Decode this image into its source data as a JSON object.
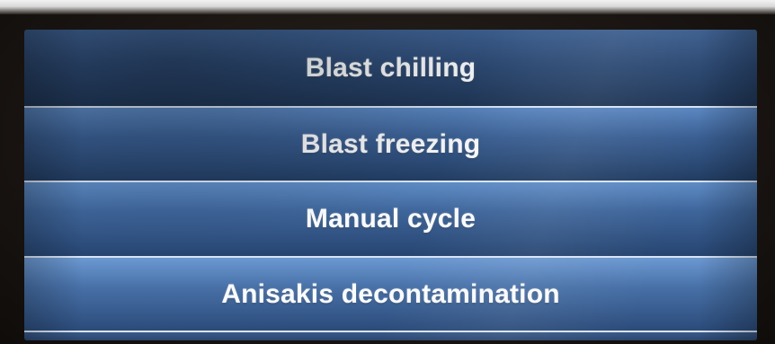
{
  "menu": {
    "items": [
      {
        "label": "Blast chilling"
      },
      {
        "label": "Blast freezing"
      },
      {
        "label": "Manual cycle"
      },
      {
        "label": "Anisakis decontamination"
      }
    ]
  },
  "colors": {
    "screen_background": "#1b2a40",
    "button_top": "#5a86c0",
    "button_bottom": "#223d63",
    "divider": "#d8e4f4",
    "label_text": "#f8fbff",
    "bezel": "#1a1512"
  }
}
